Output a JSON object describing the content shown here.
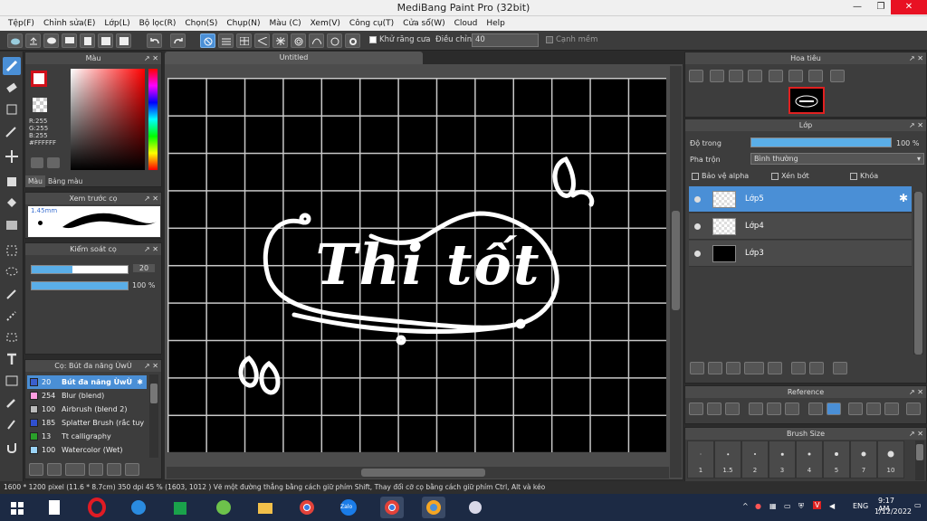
{
  "window": {
    "title": "MediBang Paint Pro (32bit)",
    "minimize": "—",
    "maximize": "❐",
    "close": "✕"
  },
  "menu": [
    "Tệp(F)",
    "Chỉnh sửa(E)",
    "Lớp(L)",
    "Bộ lọc(R)",
    "Chọn(S)",
    "Chụp(N)",
    "Màu (C)",
    "Xem(V)",
    "Công cụ(T)",
    "Cửa sổ(W)",
    "Cloud",
    "Help"
  ],
  "toolbar": {
    "antialias_label": "Khử răng cưa",
    "correction_label": "Điều chỉnh",
    "correction_value": "40",
    "edge_label": "Cạnh mềm"
  },
  "color_panel": {
    "title": "Màu",
    "r": "R:255",
    "g": "G:255",
    "b": "B:255",
    "hex": "#FFFFFF",
    "tab_color": "Màu",
    "tab_palette": "Bảng màu"
  },
  "brush_preview": {
    "title": "Xem trước cọ",
    "size": "1.45mm"
  },
  "brush_control": {
    "title": "Kiểm soát cọ",
    "size_value": "20",
    "size_fraction": 0.42,
    "opacity_value": "100 %",
    "opacity_fraction": 1.0
  },
  "brush_list": {
    "title": "Cọ: Bút đa năng ÙwÙ",
    "items": [
      {
        "num": "20",
        "name": "Bút đa năng ÙwÙ",
        "color": "#3a5fcf",
        "selected": true
      },
      {
        "num": "254",
        "name": "Blur (blend)",
        "color": "#ff9de0",
        "selected": false
      },
      {
        "num": "100",
        "name": "Airbrush (blend 2)",
        "color": "#bbbbbb",
        "selected": false
      },
      {
        "num": "185",
        "name": "Splatter Brush (rắc tuy",
        "color": "#3050d0",
        "selected": false
      },
      {
        "num": "13",
        "name": "Tt calligraphy",
        "color": "#2aa02a",
        "selected": false
      },
      {
        "num": "100",
        "name": "Watercolor (Wet)",
        "color": "#9bd3f5",
        "selected": false
      }
    ]
  },
  "document": {
    "tab": "Untitled",
    "artwork_text": "Thi tốt"
  },
  "navigator": {
    "title": "Hoa tiêu"
  },
  "layers": {
    "title": "Lớp",
    "opacity_label": "Độ trong",
    "opacity_value": "100 %",
    "opacity_fraction": 1.0,
    "blend_label": "Pha trộn",
    "blend_value": "Bình thường",
    "protect_alpha": "Bảo vệ alpha",
    "clipping": "Xén bớt",
    "lock": "Khóa",
    "items": [
      {
        "name": "Lớp5",
        "selected": true,
        "thumb": "white"
      },
      {
        "name": "Lớp4",
        "selected": false,
        "thumb": "white"
      },
      {
        "name": "Lớp3",
        "selected": false,
        "thumb": "black"
      }
    ]
  },
  "reference": {
    "title": "Reference"
  },
  "brush_size": {
    "title": "Brush Size",
    "sizes": [
      "1",
      "1.5",
      "2",
      "3",
      "4",
      "5",
      "7",
      "10"
    ]
  },
  "status": {
    "text": "1600 * 1200 pixel   (11.6 * 8.7cm)   350 dpi   45 %   (1603, 1012 )   Vẽ một đường thẳng bằng cách giữ phím Shift, Thay đổi cỡ cọ bằng cách giữ phím Ctrl, Alt và kéo"
  },
  "taskbar": {
    "lang": "ENG",
    "time": "9:17 AM",
    "date": "1/12/2022",
    "zalo": "Zalo"
  },
  "colors": {
    "accent": "#4a8fd6",
    "close": "#e81123",
    "canvas": "#000000",
    "panel": "#3d3d3d"
  }
}
